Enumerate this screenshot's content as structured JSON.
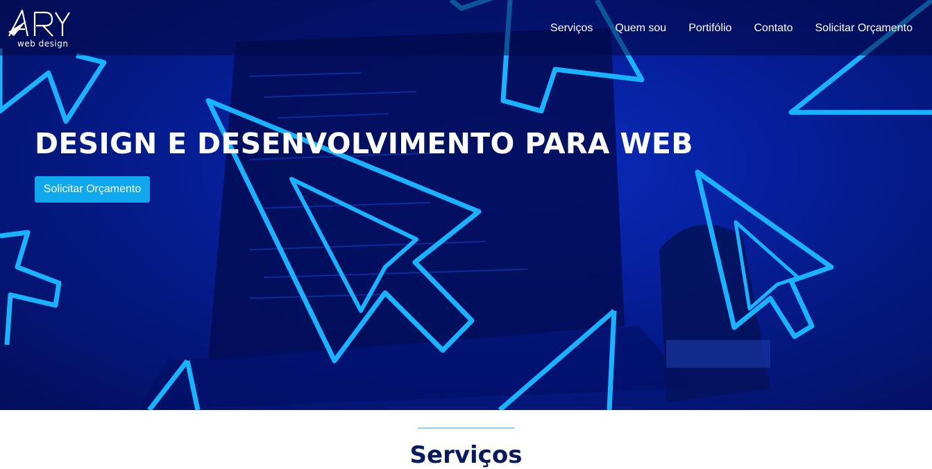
{
  "brand": {
    "logo_text": "web design"
  },
  "nav": {
    "items": [
      "Serviços",
      "Quem sou",
      "Portifólio",
      "Contato",
      "Solicitar Orçamento"
    ]
  },
  "hero": {
    "title": "DESIGN E DESENVOLVIMENTO PARA WEB",
    "cta_label": "Solicitar Orçamento"
  },
  "services": {
    "title": "Serviços"
  },
  "colors": {
    "accent": "#0fa8ee",
    "arrow_neon": "#18b4ff",
    "hero_bg": "#061f9a",
    "heading_dark": "#0a1a5e"
  }
}
